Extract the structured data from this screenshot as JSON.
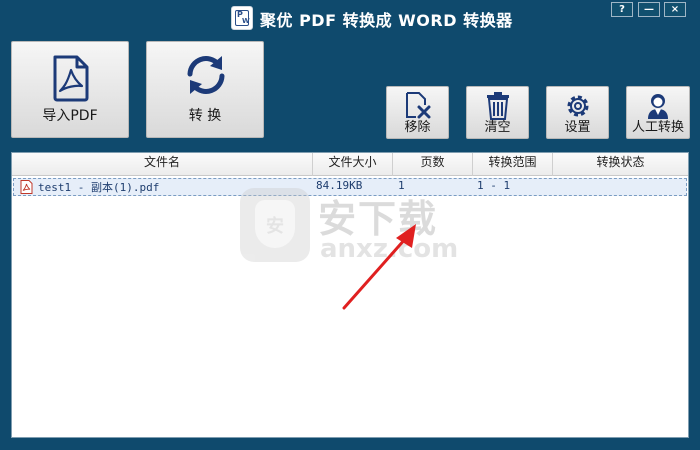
{
  "window": {
    "title": "聚优 PDF 转换成 WORD 转换器",
    "buttons": {
      "help": "?",
      "minimize": "—",
      "close": "×"
    }
  },
  "toolbar": {
    "import_label": "导入PDF",
    "convert_label": "转 换",
    "remove_label": "移除",
    "clear_label": "清空",
    "settings_label": "设置",
    "manual_label": "人工转换"
  },
  "table": {
    "columns": [
      "文件名",
      "文件大小",
      "页数",
      "转换范围",
      "转换状态"
    ],
    "rows": [
      {
        "name": "test1 - 副本(1).pdf",
        "size": "84.19KB",
        "pages": "1",
        "range": "1 - 1",
        "status": ""
      }
    ]
  },
  "watermark": {
    "big": "安下载",
    "small": "anxz.com"
  },
  "colors": {
    "background": "#0f4a6d",
    "accent": "#1c3a78",
    "row_highlight": "#e6eef9"
  }
}
